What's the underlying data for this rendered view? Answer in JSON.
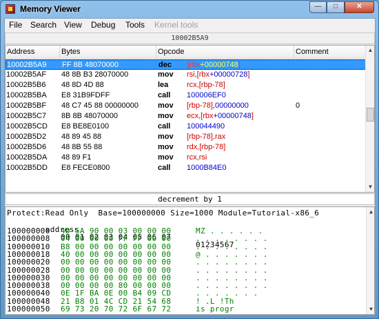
{
  "window": {
    "title": "Memory Viewer",
    "minimize": "—",
    "maximize": "□",
    "close": "✕"
  },
  "menu": [
    {
      "label": "File",
      "enabled": true
    },
    {
      "label": "Search",
      "enabled": true
    },
    {
      "label": "View",
      "enabled": true
    },
    {
      "label": "Debug",
      "enabled": true
    },
    {
      "label": "Tools",
      "enabled": true
    },
    {
      "label": "Kernel tools",
      "enabled": false
    }
  ],
  "current_address": "10002B5A9",
  "disassembler": {
    "columns": [
      "Address",
      "Bytes",
      "Opcode",
      "Comment"
    ],
    "rows": [
      {
        "address": "10002B5A9",
        "bytes": "FF 8B 48070000",
        "op": "dec",
        "args": [
          [
            "reg",
            "[rbx"
          ],
          [
            "num",
            "+00000748"
          ],
          [
            "reg",
            "]"
          ]
        ],
        "comment": "",
        "selected": true
      },
      {
        "address": "10002B5AF",
        "bytes": "48 8B B3 28070000",
        "op": "mov",
        "args": [
          [
            "reg",
            "rsi,[rbx"
          ],
          [
            "num",
            "+00000728"
          ],
          [
            "reg",
            "]"
          ]
        ],
        "comment": ""
      },
      {
        "address": "10002B5B6",
        "bytes": "48 8D 4D 88",
        "op": "lea",
        "args": [
          [
            "reg",
            "rcx,[rbp-78]"
          ]
        ],
        "comment": ""
      },
      {
        "address": "10002B5BA",
        "bytes": "E8 31B9FDFF",
        "op": "call",
        "args": [
          [
            "num",
            "100006EF0"
          ]
        ],
        "comment": ""
      },
      {
        "address": "10002B5BF",
        "bytes": "48 C7 45 88 00000000",
        "op": "mov",
        "args": [
          [
            "reg",
            "[rbp-78]"
          ],
          [
            "num",
            ",00000000"
          ]
        ],
        "comment": "0"
      },
      {
        "address": "10002B5C7",
        "bytes": "8B 8B 48070000",
        "op": "mov",
        "args": [
          [
            "reg",
            "ecx,[rbx"
          ],
          [
            "num",
            "+00000748"
          ],
          [
            "reg",
            "]"
          ]
        ],
        "comment": ""
      },
      {
        "address": "10002B5CD",
        "bytes": "E8 BE8E0100",
        "op": "call",
        "args": [
          [
            "num",
            "100044490"
          ]
        ],
        "comment": ""
      },
      {
        "address": "10002B5D2",
        "bytes": "48 89 45 88",
        "op": "mov",
        "args": [
          [
            "reg",
            "[rbp-78],rax"
          ]
        ],
        "comment": ""
      },
      {
        "address": "10002B5D6",
        "bytes": "48 8B 55 88",
        "op": "mov",
        "args": [
          [
            "reg",
            "rdx,[rbp-78]"
          ]
        ],
        "comment": ""
      },
      {
        "address": "10002B5DA",
        "bytes": "48 89 F1",
        "op": "mov",
        "args": [
          [
            "reg",
            "rcx,rsi"
          ]
        ],
        "comment": ""
      },
      {
        "address": "10002B5DD",
        "bytes": "E8 FECE0800",
        "op": "call",
        "args": [
          [
            "num",
            "1000B84E0"
          ]
        ],
        "comment": ""
      }
    ]
  },
  "hint": "decrement by 1",
  "hex": {
    "info": "Protect:Read Only  Base=100000000 Size=1000 Module=Tutorial-x86_6",
    "header": {
      "label": "address",
      "bytes": "00 01 02 03 04 05 06 07",
      "ascii": "01234567"
    },
    "rows": [
      {
        "address": "100000000",
        "bytes": "4D 5A 90 00 03 00 00 00",
        "ascii": "MZ . . . . . ."
      },
      {
        "address": "100000008",
        "bytes": "04 00 00 00 FF FF 00 00",
        "ascii": ". . . . . . . ."
      },
      {
        "address": "100000010",
        "bytes": "B8 00 00 00 00 00 00 00",
        "ascii": ". . . . . . . ."
      },
      {
        "address": "100000018",
        "bytes": "40 00 00 00 00 00 00 00",
        "ascii": "@ . . . . . . ."
      },
      {
        "address": "100000020",
        "bytes": "00 00 00 00 00 00 00 00",
        "ascii": ". . . . . . . ."
      },
      {
        "address": "100000028",
        "bytes": "00 00 00 00 00 00 00 00",
        "ascii": ". . . . . . . ."
      },
      {
        "address": "100000030",
        "bytes": "00 00 00 00 00 00 00 00",
        "ascii": ". . . . . . . ."
      },
      {
        "address": "100000038",
        "bytes": "00 00 00 00 80 00 00 00",
        "ascii": ". . . . . . . ."
      },
      {
        "address": "100000040",
        "bytes": "0E 1F BA 0E 00 B4 09 CD",
        "ascii": ". . . . . . ."
      },
      {
        "address": "100000048",
        "bytes": "21 B8 01 4C CD 21 54 68",
        "ascii": "! .L !Th"
      },
      {
        "address": "100000050",
        "bytes": "69 73 20 70 72 6F 67 72",
        "ascii": "is progr"
      }
    ]
  }
}
